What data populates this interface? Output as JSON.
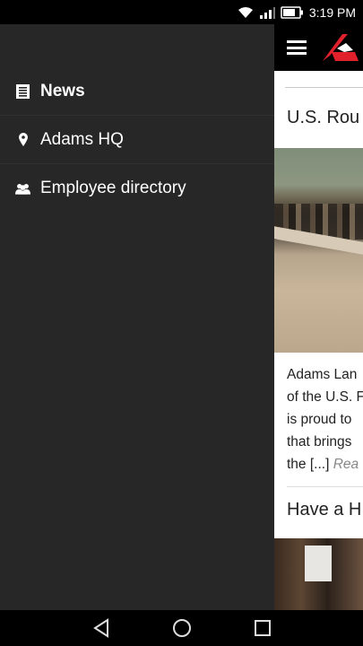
{
  "status_bar": {
    "time": "3:19 PM",
    "icons": [
      "wifi-icon",
      "signal-icon",
      "battery-icon"
    ]
  },
  "drawer": {
    "items": [
      {
        "label": "News",
        "icon": "document-icon",
        "active": true
      },
      {
        "label": "Adams HQ",
        "icon": "location-pin-icon",
        "active": false
      },
      {
        "label": "Employee directory",
        "icon": "people-icon",
        "active": false
      }
    ]
  },
  "content": {
    "article1_title": "U.S. Rou",
    "excerpt_lines": [
      "Adams Lan",
      "of the U.S. F",
      "is proud to",
      "that brings",
      "the [...]"
    ],
    "read_more": "Rea",
    "article2_title": "Have a H"
  },
  "colors": {
    "drawer_bg": "#272727",
    "app_bar_bg": "#000000",
    "logo_red": "#e0202a"
  },
  "nav_bar": {
    "buttons": [
      "back-icon",
      "home-icon",
      "recents-icon"
    ]
  }
}
